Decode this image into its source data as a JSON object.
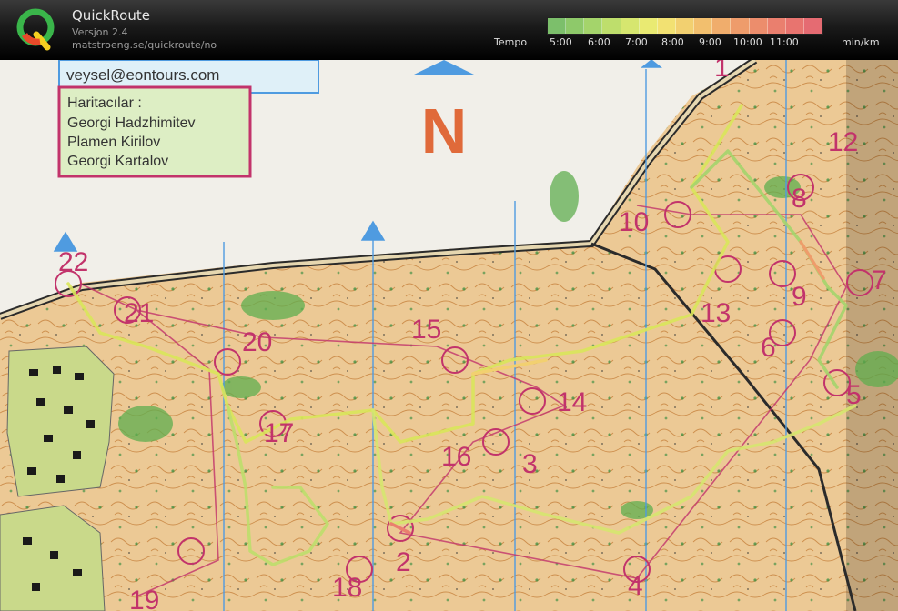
{
  "app": {
    "name": "QuickRoute",
    "version": "Versjon 2.4",
    "url": "matstroeng.se/quickroute/no"
  },
  "legend": {
    "label": "Tempo",
    "unit": "min/km",
    "ticks": [
      "5:00",
      "6:00",
      "7:00",
      "8:00",
      "9:00",
      "10:00",
      "11:00"
    ],
    "colors": [
      "#7cbf6b",
      "#8ec96a",
      "#a4d46b",
      "#bede6c",
      "#d6e66f",
      "#e9ea72",
      "#f2e172",
      "#f2d070",
      "#f2bf6e",
      "#f0ad6c",
      "#ee9c6b",
      "#ec8d6c",
      "#ea7f6e",
      "#e8746f",
      "#e56b72"
    ]
  },
  "map": {
    "email": "veysel@eontours.com",
    "credits_title": "Haritacılar :",
    "credits": [
      "Georgi Hadzhimitev",
      "Plamen Kirilov",
      "Georgi Kartalov"
    ],
    "north": "N",
    "controls": [
      {
        "n": "1"
      },
      {
        "n": "2"
      },
      {
        "n": "3"
      },
      {
        "n": "4"
      },
      {
        "n": "5"
      },
      {
        "n": "6"
      },
      {
        "n": "7"
      },
      {
        "n": "8"
      },
      {
        "n": "9"
      },
      {
        "n": "10"
      },
      {
        "n": "12"
      },
      {
        "n": "13"
      },
      {
        "n": "14"
      },
      {
        "n": "15"
      },
      {
        "n": "16"
      },
      {
        "n": "17"
      },
      {
        "n": "18"
      },
      {
        "n": "19"
      },
      {
        "n": "20"
      },
      {
        "n": "21"
      },
      {
        "n": "22"
      }
    ]
  }
}
